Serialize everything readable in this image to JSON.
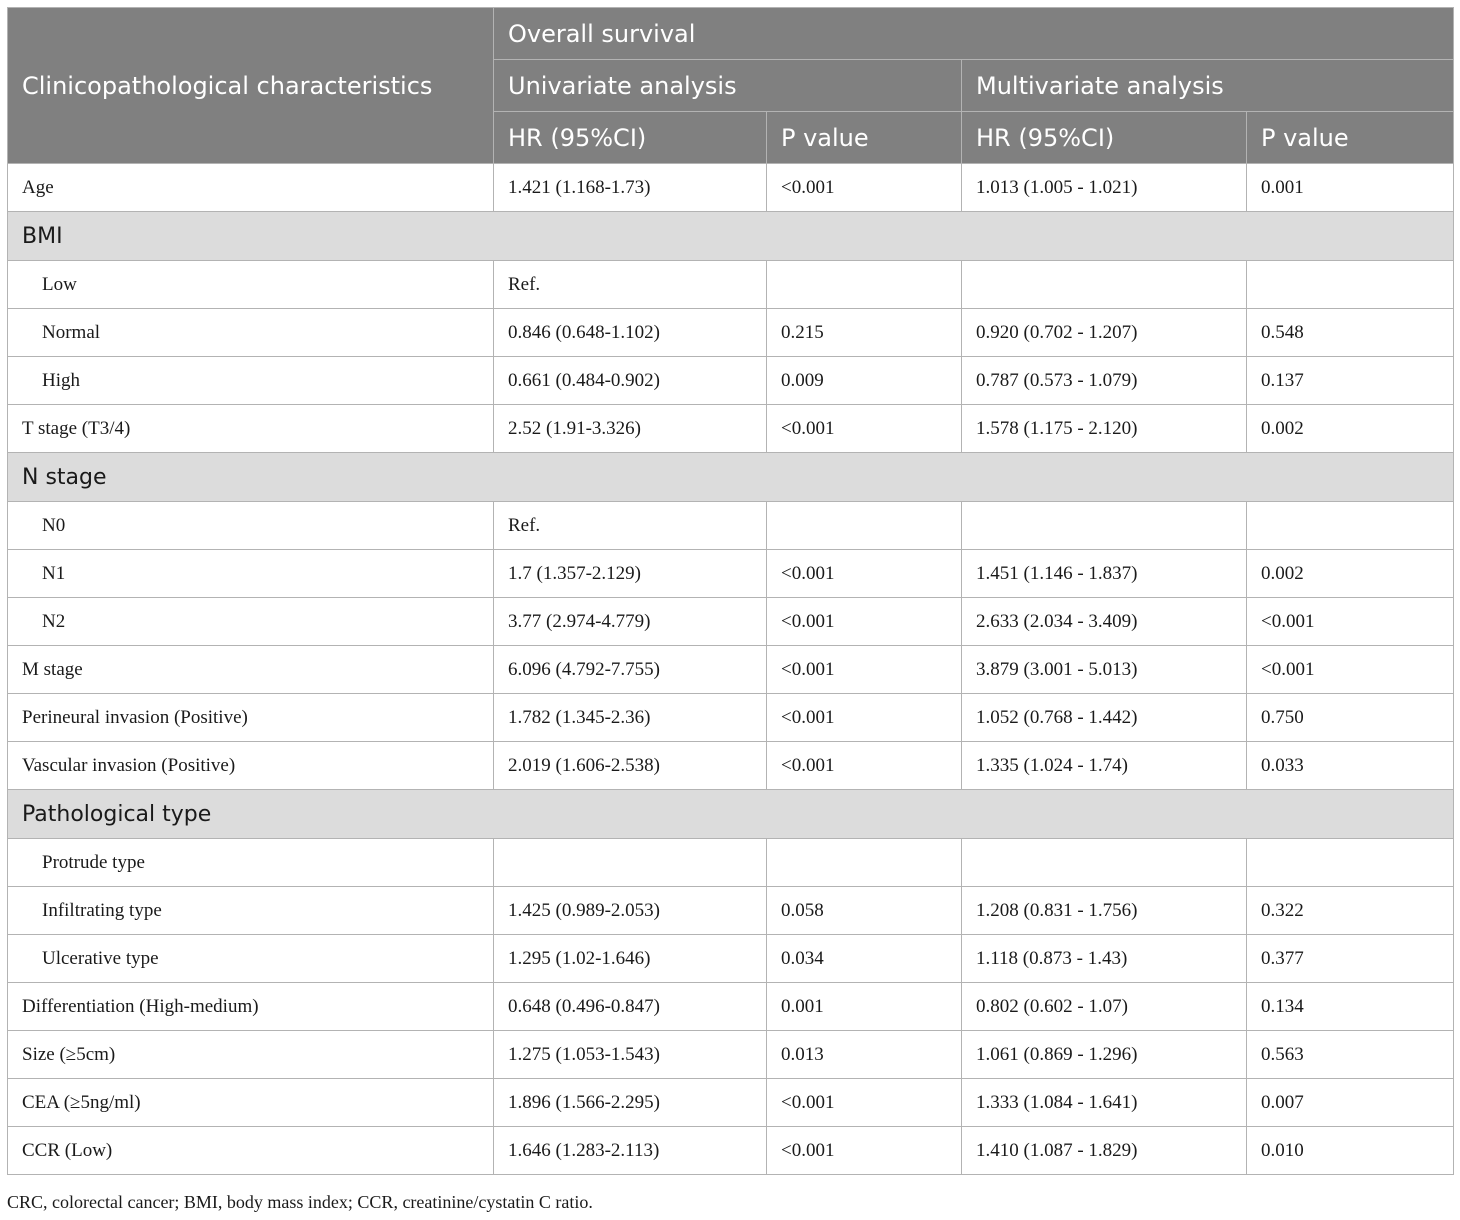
{
  "table": {
    "header": {
      "characteristics": "Clinicopathological characteristics",
      "overall_survival": "Overall survival",
      "univariate": "Univariate analysis",
      "multivariate": "Multivariate analysis",
      "hr_uni": "HR (95%CI)",
      "p_uni": "P value",
      "hr_multi": "HR (95%CI)",
      "p_multi": "P value"
    },
    "rows": [
      {
        "type": "data",
        "label": "Age",
        "indent": false,
        "uni_hr": "1.421 (1.168-1.73)",
        "uni_p": "<0.001",
        "multi_hr": "1.013 (1.005 - 1.021)",
        "multi_p": "0.001"
      },
      {
        "type": "group",
        "label": "BMI"
      },
      {
        "type": "data",
        "label": "Low",
        "indent": true,
        "uni_hr": "Ref.",
        "uni_p": "",
        "multi_hr": "",
        "multi_p": ""
      },
      {
        "type": "data",
        "label": "Normal",
        "indent": true,
        "uni_hr": "0.846 (0.648-1.102)",
        "uni_p": "0.215",
        "multi_hr": "0.920 (0.702 - 1.207)",
        "multi_p": "0.548"
      },
      {
        "type": "data",
        "label": "High",
        "indent": true,
        "uni_hr": "0.661 (0.484-0.902)",
        "uni_p": "0.009",
        "multi_hr": "0.787 (0.573 - 1.079)",
        "multi_p": "0.137"
      },
      {
        "type": "data",
        "label": "T stage (T3/4)",
        "indent": false,
        "uni_hr": "2.52 (1.91-3.326)",
        "uni_p": "<0.001",
        "multi_hr": "1.578 (1.175 - 2.120)",
        "multi_p": "0.002"
      },
      {
        "type": "group",
        "label": "N stage"
      },
      {
        "type": "data",
        "label": "N0",
        "indent": true,
        "uni_hr": "Ref.",
        "uni_p": "",
        "multi_hr": "",
        "multi_p": ""
      },
      {
        "type": "data",
        "label": "N1",
        "indent": true,
        "uni_hr": "1.7 (1.357-2.129)",
        "uni_p": "<0.001",
        "multi_hr": "1.451 (1.146 - 1.837)",
        "multi_p": "0.002"
      },
      {
        "type": "data",
        "label": "N2",
        "indent": true,
        "uni_hr": "3.77 (2.974-4.779)",
        "uni_p": "<0.001",
        "multi_hr": "2.633 (2.034 - 3.409)",
        "multi_p": "<0.001"
      },
      {
        "type": "data",
        "label": "M stage",
        "indent": false,
        "uni_hr": "6.096 (4.792-7.755)",
        "uni_p": "<0.001",
        "multi_hr": "3.879 (3.001 - 5.013)",
        "multi_p": "<0.001"
      },
      {
        "type": "data",
        "label": "Perineural invasion (Positive)",
        "indent": false,
        "uni_hr": "1.782 (1.345-2.36)",
        "uni_p": "<0.001",
        "multi_hr": "1.052 (0.768 - 1.442)",
        "multi_p": "0.750"
      },
      {
        "type": "data",
        "label": "Vascular invasion (Positive)",
        "indent": false,
        "uni_hr": "2.019 (1.606-2.538)",
        "uni_p": "<0.001",
        "multi_hr": "1.335 (1.024 - 1.74)",
        "multi_p": "0.033"
      },
      {
        "type": "group",
        "label": "Pathological type"
      },
      {
        "type": "data",
        "label": "Protrude type",
        "indent": true,
        "uni_hr": "",
        "uni_p": "",
        "multi_hr": "",
        "multi_p": ""
      },
      {
        "type": "data",
        "label": "Infiltrating type",
        "indent": true,
        "uni_hr": "1.425 (0.989-2.053)",
        "uni_p": "0.058",
        "multi_hr": "1.208 (0.831 - 1.756)",
        "multi_p": "0.322"
      },
      {
        "type": "data",
        "label": "Ulcerative type",
        "indent": true,
        "uni_hr": "1.295 (1.02-1.646)",
        "uni_p": "0.034",
        "multi_hr": "1.118 (0.873 - 1.43)",
        "multi_p": "0.377"
      },
      {
        "type": "data",
        "label": "Differentiation (High-medium)",
        "indent": false,
        "uni_hr": "0.648 (0.496-0.847)",
        "uni_p": "0.001",
        "multi_hr": "0.802 (0.602 - 1.07)",
        "multi_p": "0.134"
      },
      {
        "type": "data",
        "label": "Size (≥5cm)",
        "indent": false,
        "uni_hr": "1.275 (1.053-1.543)",
        "uni_p": "0.013",
        "multi_hr": "1.061 (0.869 - 1.296)",
        "multi_p": "0.563"
      },
      {
        "type": "data",
        "label": "CEA (≥5ng/ml)",
        "indent": false,
        "uni_hr": "1.896 (1.566-2.295)",
        "uni_p": "<0.001",
        "multi_hr": "1.333 (1.084 - 1.641)",
        "multi_p": "0.007"
      },
      {
        "type": "data",
        "label": "CCR (Low)",
        "indent": false,
        "uni_hr": "1.646 (1.283-2.113)",
        "uni_p": "<0.001",
        "multi_hr": "1.410 (1.087 - 1.829)",
        "multi_p": "0.010"
      }
    ]
  },
  "footnote": "CRC, colorectal cancer; BMI, body mass index; CCR, creatinine/cystatin C ratio."
}
